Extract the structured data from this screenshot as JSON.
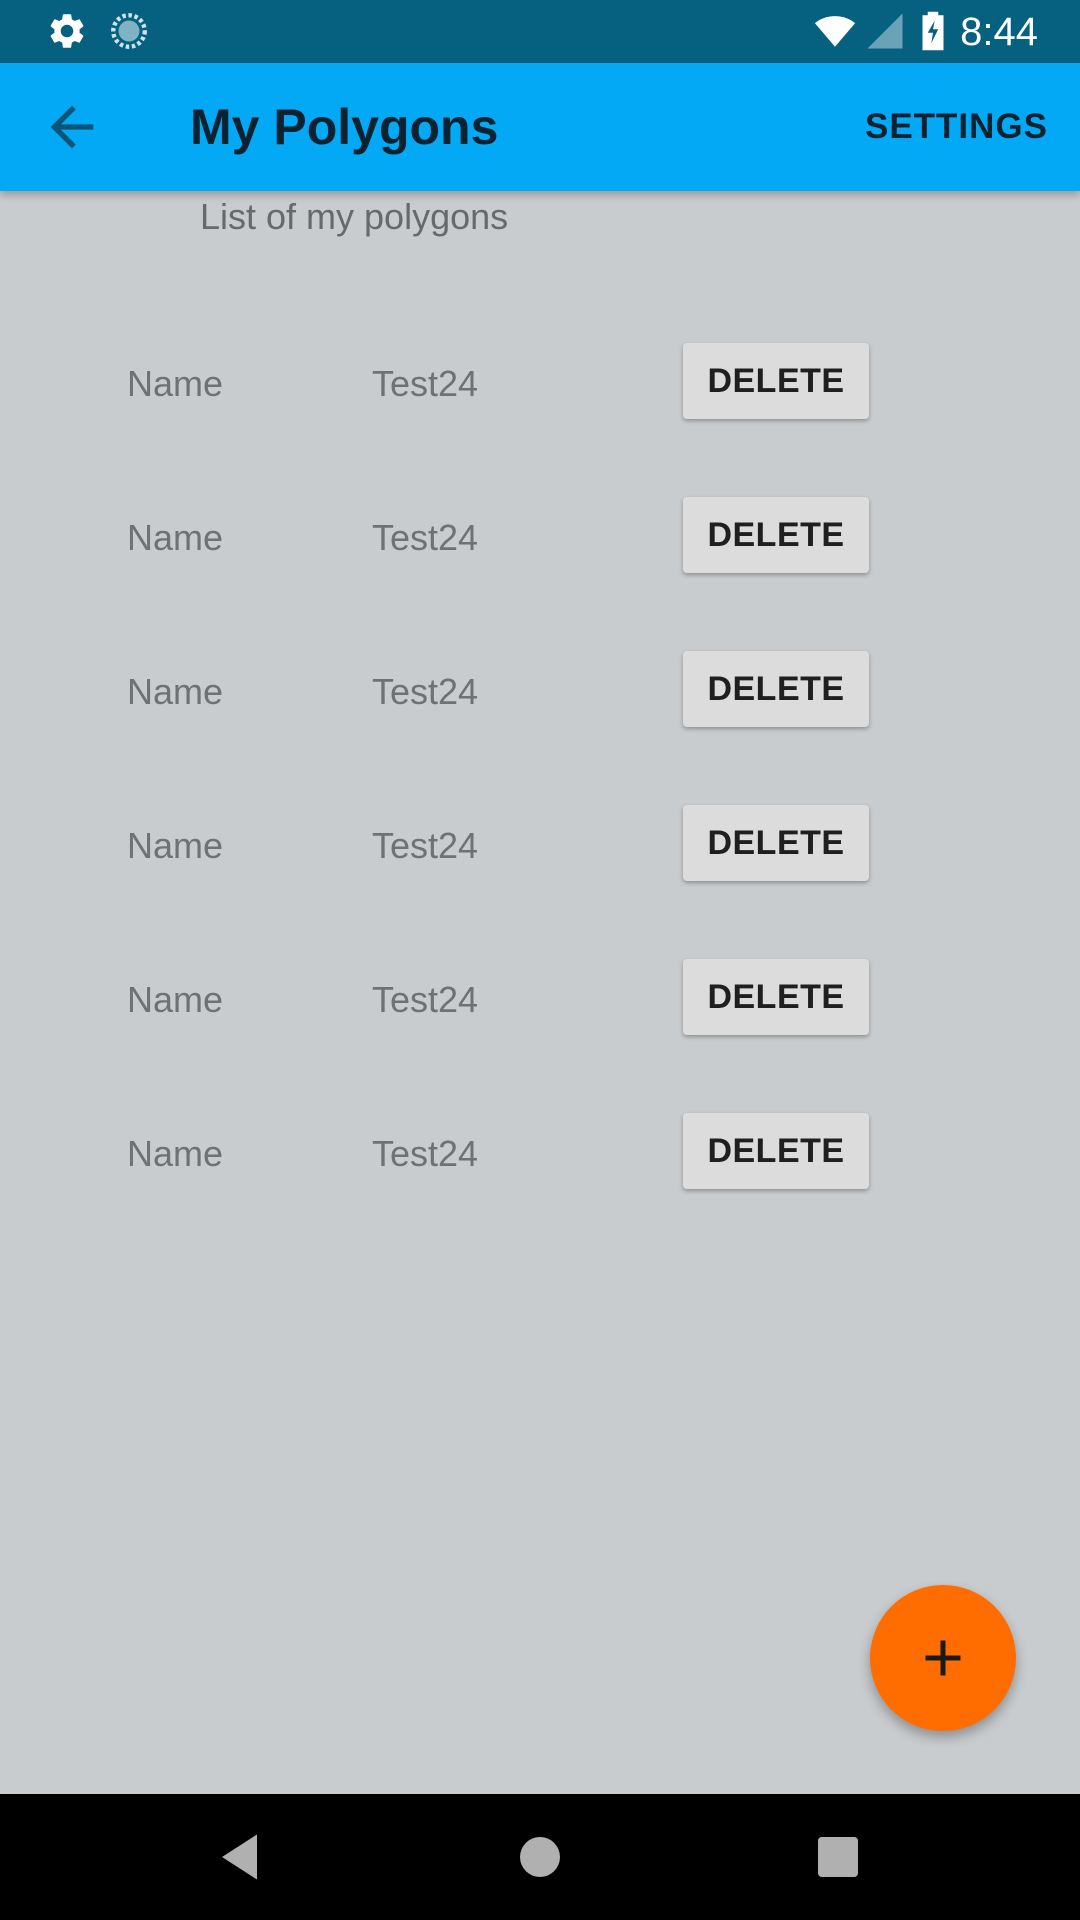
{
  "status_bar": {
    "time": "8:44",
    "icons": [
      "settings-gear-icon",
      "sync-progress-icon",
      "wifi-icon",
      "cell-signal-icon",
      "battery-charging-icon"
    ]
  },
  "app_bar": {
    "title": "My Polygons",
    "back_icon": "arrow-back-icon",
    "settings_label": "SETTINGS",
    "color": "#03a9f4"
  },
  "content": {
    "subtitle": "List of my polygons",
    "rows": [
      {
        "label": "Name",
        "value": "Test24",
        "action": "DELETE"
      },
      {
        "label": "Name",
        "value": "Test24",
        "action": "DELETE"
      },
      {
        "label": "Name",
        "value": "Test24",
        "action": "DELETE"
      },
      {
        "label": "Name",
        "value": "Test24",
        "action": "DELETE"
      },
      {
        "label": "Name",
        "value": "Test24",
        "action": "DELETE"
      },
      {
        "label": "Name",
        "value": "Test24",
        "action": "DELETE"
      }
    ]
  },
  "fab": {
    "icon": "plus-icon",
    "color": "#ff6d00"
  },
  "nav_bar": {
    "icons": [
      "back-triangle-icon",
      "home-circle-icon",
      "recents-square-icon"
    ]
  }
}
